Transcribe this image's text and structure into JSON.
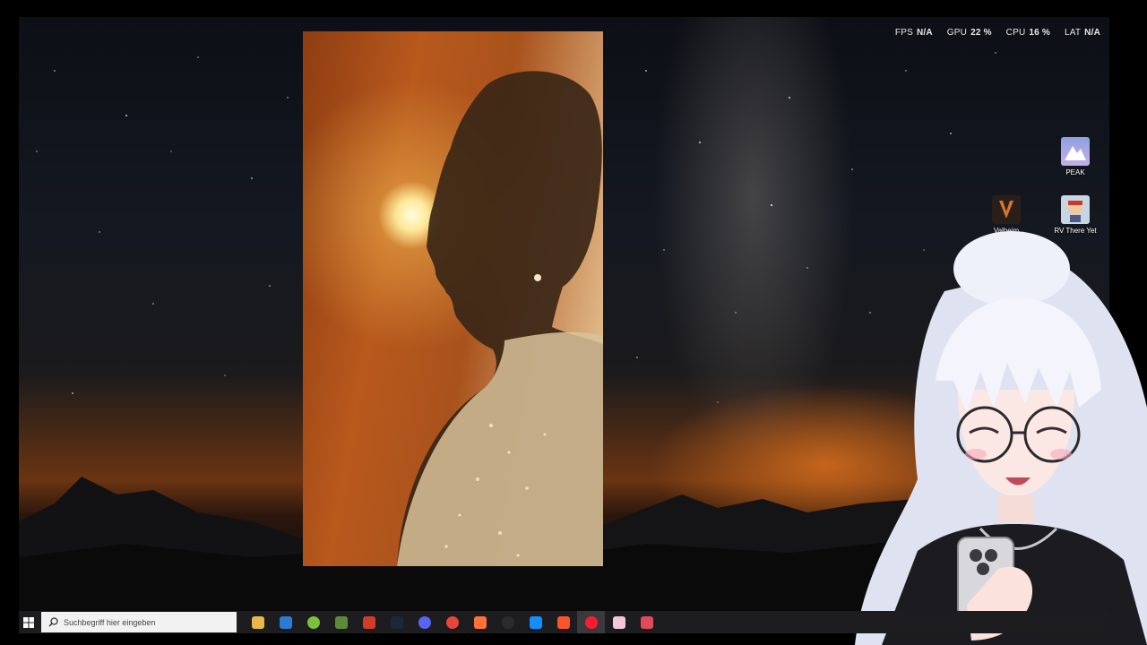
{
  "perf_overlay": {
    "fps": {
      "label": "FPS",
      "value": "N/A"
    },
    "gpu": {
      "label": "GPU",
      "value": "22 %"
    },
    "cpu": {
      "label": "CPU",
      "value": "16 %"
    },
    "lat": {
      "label": "LAT",
      "value": "N/A"
    }
  },
  "desktop_icons": [
    {
      "label": "PEAK",
      "icon": "peak-game-icon",
      "color": "#7a86c8"
    },
    {
      "label": "Valheim",
      "icon": "valheim-game-icon",
      "color": "#3a2a22"
    },
    {
      "label": "RV There Yet",
      "icon": "rv-there-yet-game-icon",
      "color": "#b0c4d8"
    }
  ],
  "taskbar": {
    "search_placeholder": "Suchbegriff hier eingeben",
    "apps": [
      {
        "name": "file-explorer-icon",
        "color": "#e8b84a",
        "glyph": ""
      },
      {
        "name": "microsoft-store-icon",
        "color": "#2b7bd6",
        "glyph": ""
      },
      {
        "name": "xbox-app-icon",
        "color": "#7cc13a",
        "glyph": ""
      },
      {
        "name": "minecraft-launcher-icon",
        "color": "#5d8a3a",
        "glyph": ""
      },
      {
        "name": "snack-game-icon",
        "color": "#d23a2a",
        "glyph": ""
      },
      {
        "name": "steam-icon",
        "color": "#1b2838",
        "glyph": ""
      },
      {
        "name": "discord-icon",
        "color": "#5865f2",
        "glyph": ""
      },
      {
        "name": "chrome-icon",
        "color": "#e8453c",
        "glyph": ""
      },
      {
        "name": "firefox-icon",
        "color": "#ff7139",
        "glyph": ""
      },
      {
        "name": "obs-icon",
        "color": "#2b2b2b",
        "glyph": ""
      },
      {
        "name": "battle-net-icon",
        "color": "#148eff",
        "glyph": ""
      },
      {
        "name": "brave-icon",
        "color": "#fb542b",
        "glyph": ""
      },
      {
        "name": "opera-icon",
        "color": "#ff1b2d",
        "glyph": ""
      },
      {
        "name": "vtube-studio-icon",
        "color": "#f4c6d8",
        "glyph": ""
      },
      {
        "name": "app-link-icon",
        "color": "#e04a5a",
        "glyph": ""
      }
    ],
    "active_app": "opera-icon"
  }
}
